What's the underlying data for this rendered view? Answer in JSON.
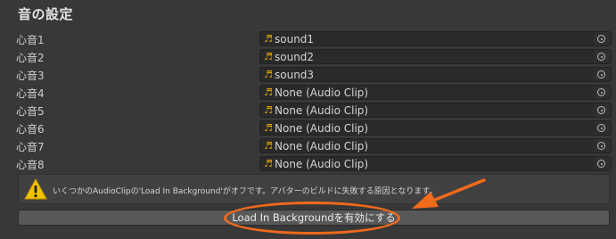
{
  "section": {
    "title": "音の設定"
  },
  "rows": [
    {
      "label": "心音1",
      "value": "sound1"
    },
    {
      "label": "心音2",
      "value": "sound2"
    },
    {
      "label": "心音3",
      "value": "sound3"
    },
    {
      "label": "心音4",
      "value": "None (Audio Clip)"
    },
    {
      "label": "心音5",
      "value": "None (Audio Clip)"
    },
    {
      "label": "心音6",
      "value": "None (Audio Clip)"
    },
    {
      "label": "心音7",
      "value": "None (Audio Clip)"
    },
    {
      "label": "心音8",
      "value": "None (Audio Clip)"
    }
  ],
  "icons": {
    "clip": "music-note-icon",
    "picker": "object-picker-icon",
    "warning": "warning-triangle-icon"
  },
  "music_glyph": "♬",
  "warning": {
    "text": "いくつかのAudioClipの'Load In Background'がオフです。アバターのビルドに失敗する原因となります。"
  },
  "action_button": {
    "label": "Load In Backgroundを有効にする"
  },
  "colors": {
    "accent_annotation": "#f26a1b",
    "warning_yellow": "#f2c200",
    "clip_icon": "#e0a400"
  }
}
